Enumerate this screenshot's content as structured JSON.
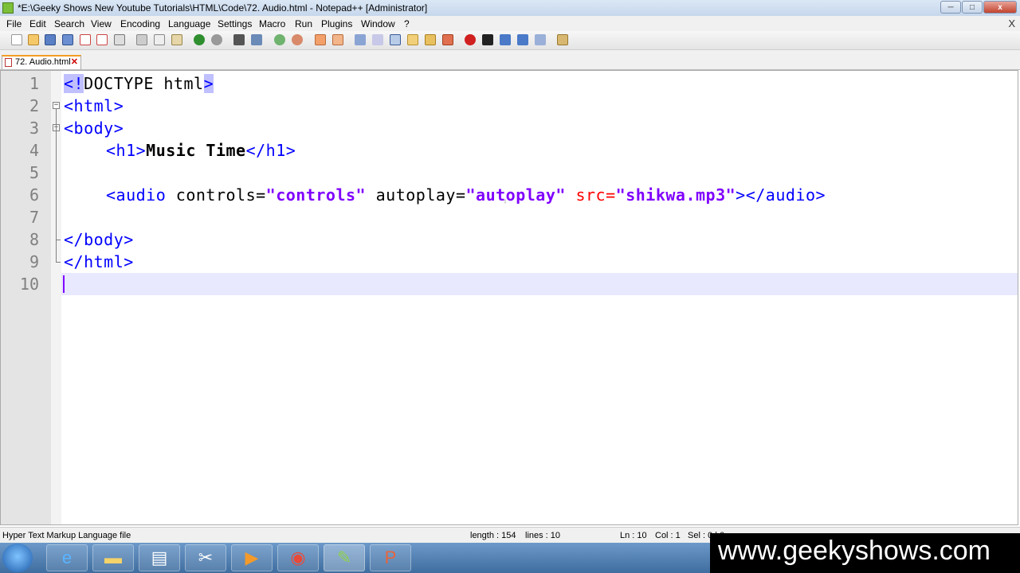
{
  "window": {
    "title": "*E:\\Geeky Shows New Youtube Tutorials\\HTML\\Code\\72. Audio.html - Notepad++ [Administrator]",
    "minimize": "─",
    "maximize": "□",
    "close": "x"
  },
  "menu": {
    "items": [
      "File",
      "Edit",
      "Search",
      "View",
      "Encoding",
      "Language",
      "Settings",
      "Macro",
      "Run",
      "Plugins",
      "Window",
      "?"
    ],
    "close_glyph": "X"
  },
  "tab": {
    "label": "72. Audio.html",
    "close_glyph": "✕"
  },
  "editor": {
    "line_numbers": [
      "1",
      "2",
      "3",
      "4",
      "5",
      "6",
      "7",
      "8",
      "9",
      "10"
    ],
    "lines": {
      "l1_a": "<!",
      "l1_b": "DOCTYPE html",
      "l1_c": ">",
      "l2": "<html>",
      "l3": "<body>",
      "l4_tag1": "<h1>",
      "l4_text": "Music Time",
      "l4_tag2": "</h1>",
      "l6_tag1": "<audio",
      "l6_attr1": " controls=",
      "l6_val1": "\"controls\"",
      "l6_attr2": " autoplay=",
      "l6_val2": "\"autoplay\"",
      "l6_attr3": " src=",
      "l6_val3": "\"shikwa.mp3\"",
      "l6_tag2": "></audio>",
      "l8": "</body>",
      "l9": "</html>"
    }
  },
  "status": {
    "file_type": "Hyper Text Markup Language file",
    "length": "length : 154",
    "lines": "lines : 10",
    "ln": "Ln : 10",
    "col": "Col : 1",
    "sel": "Sel : 0 | 0"
  },
  "watermark": "www.geekyshows.com",
  "colors": {
    "tag": "#0000ff",
    "attr": "#ff0000",
    "value": "#8000ff",
    "gutter": "#e4e4e4",
    "caret_line": "#e8e8ff"
  },
  "taskbar": {
    "icons": [
      "start-orb-icon",
      "internet-explorer-icon",
      "file-explorer-icon",
      "book-icon",
      "snipping-tool-icon",
      "media-player-icon",
      "chrome-icon",
      "notepadpp-icon",
      "powerpoint-icon"
    ]
  }
}
